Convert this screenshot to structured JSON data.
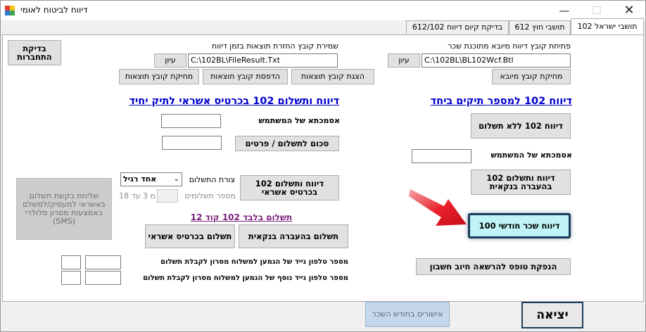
{
  "window": {
    "title": "דיווח לביטוח לאומי"
  },
  "tabs": [
    {
      "label": "102 תושבי ישראל"
    },
    {
      "label": "612 תושבי חוץ"
    },
    {
      "label": "בדיקת קיום דיווח 612/102"
    }
  ],
  "import": {
    "label": "פתיחת קובץ דיווח מיובא מתוכנת שכר",
    "path": "C:\\102BL\\BL102Wcf.Btl",
    "browse_label": "עיון",
    "delete_label": "מחיקת קובץ מיובא"
  },
  "results": {
    "label": "שמירת קובץ החזרת תוצאות בזמן דיווח",
    "path": "C:\\102BL\\FileResult.Txt",
    "browse_label": "עיון",
    "show_label": "הצגת קובץ תוצאות",
    "print_label": "הדפסת קובץ תוצאות",
    "delete_label": "מחיקת קובץ תוצאות"
  },
  "check_connection_label": "בדיקת התחברות",
  "single_file": {
    "title": "דיווח 102 למספר תיקים ביחד",
    "no_payment_label": "דיווח 102 ללא תשלום",
    "user_code_label": "אסמכתא של המשתמש",
    "user_code_value": "",
    "bank_transfer_label": "דיווח ותשלום 102 בהעברה בנקאית",
    "monthly_salary_label": "דיווח שכר חודשי 100",
    "payment_form_label": "הנפקת טופס להרשאה חיוב חשבון"
  },
  "credit": {
    "title": "דיווח ותשלום 102 בכרטיס אשראי לתיק יחיד",
    "user_code_label": "אסמכתא של המשתמש",
    "user_code_value": "",
    "amount_button": "סכום לתשלום / פרטים",
    "amount_value": "",
    "report_pay_label": "דיווח ותשלום 102 בכרטיס אשראי",
    "payment_form_label": "צורת התשלום",
    "payment_form_value": "אחד רגיל",
    "num_payments_label": "מספר תשלומים",
    "num_payments_value": "",
    "payments_range": "מ 3 עד 18",
    "sms_label": "שליחת בקשת תשלום באשראי למעסיק/למשלם באמצעות מסרון סלולרי (SMS)"
  },
  "code12": {
    "title": "תשלום בלבד 102 קוד 12",
    "bank_label": "תשלום בהעברה בנקאית",
    "credit_label": "תשלום בכרטיס אשראי"
  },
  "phones": {
    "phone1_label": "מספר טלפון נייד של הנמען למשלוח מסרון לקבלת תשלום",
    "phone2_label": "מספר טלפון נייד נוסף של הנמען למשלוח מסרון לקבלת תשלום",
    "phone1_prefix": "",
    "phone1_number": "",
    "phone2_prefix": "",
    "phone2_number": ""
  },
  "footer": {
    "approvals_label": "אישורים בחודש השכר",
    "exit_label": "יציאה"
  },
  "colors": {
    "highlight_button": "#bff3f5",
    "highlight_border": "#1a3d5c",
    "arrow": "#e8202a",
    "link_blue": "#0000cc"
  }
}
